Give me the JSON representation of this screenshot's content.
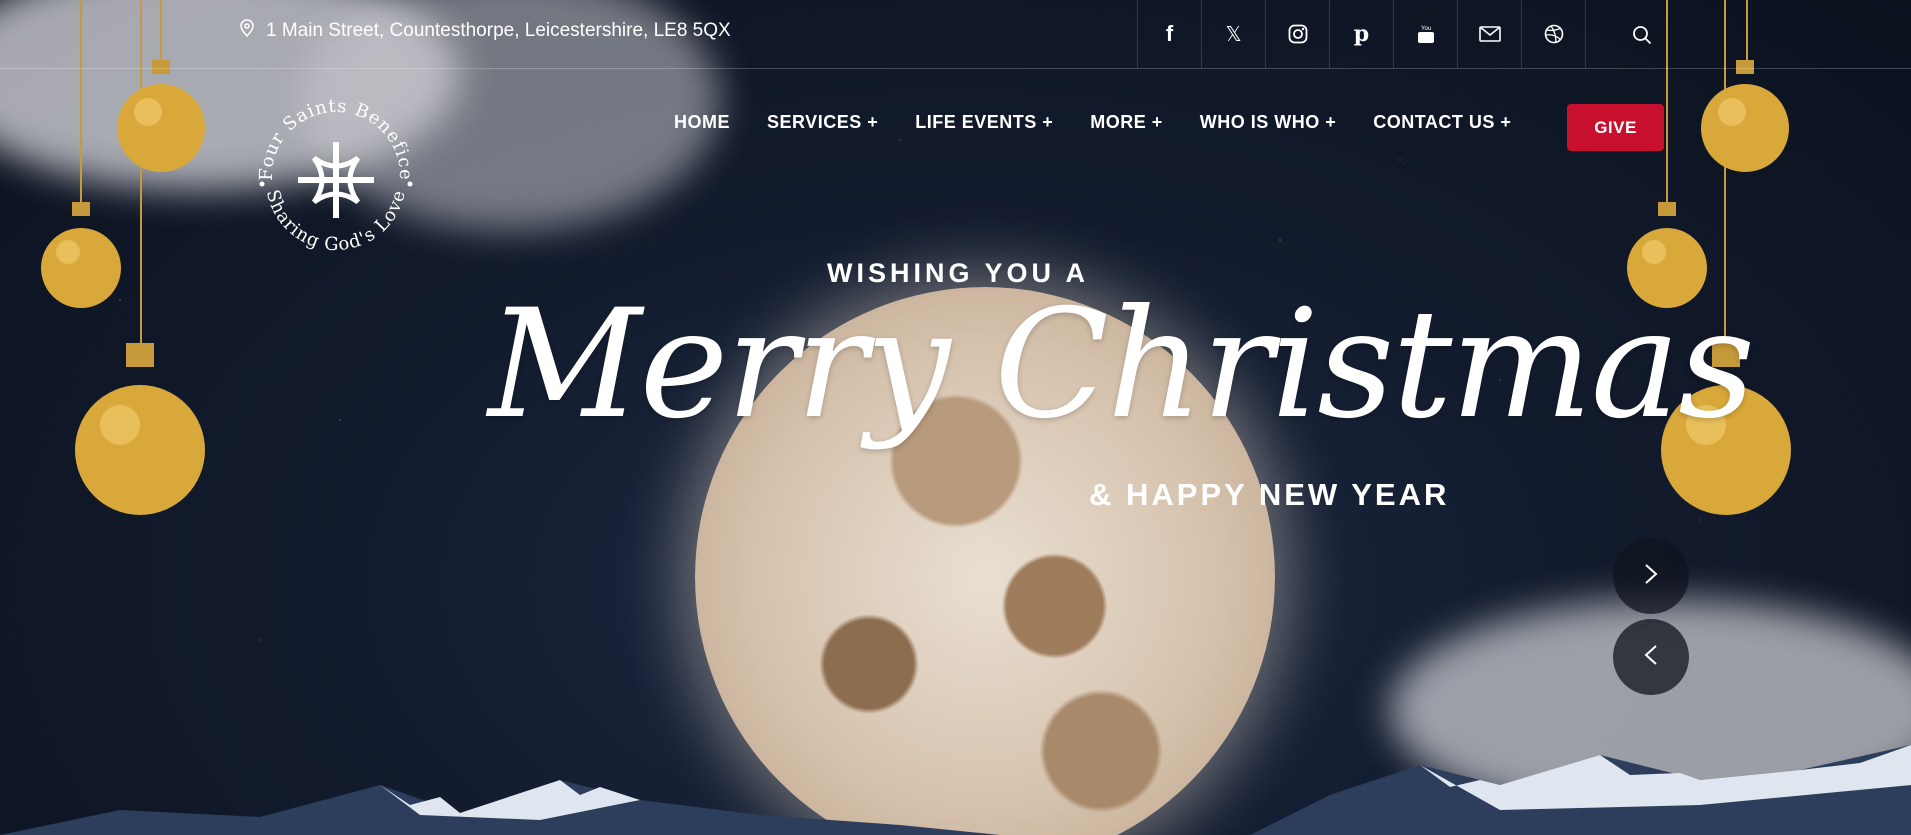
{
  "topbar": {
    "address": "1 Main Street, Countesthorpe, Leicestershire, LE8 5QX",
    "address_icon": "map-pin-icon",
    "socials": [
      {
        "name": "facebook-icon",
        "glyph": "f"
      },
      {
        "name": "x-twitter-icon",
        "glyph": "𝕏"
      },
      {
        "name": "instagram-icon",
        "glyph": "◎"
      },
      {
        "name": "pinterest-icon",
        "glyph": "𝒑"
      },
      {
        "name": "youtube-icon",
        "glyph": "▶"
      },
      {
        "name": "mail-icon",
        "glyph": "✉"
      },
      {
        "name": "dribbble-icon",
        "glyph": "⊕"
      }
    ],
    "search_icon": "search-icon"
  },
  "logo": {
    "text_top": "Four Saints Benefice",
    "text_bottom": "Sharing God's Love"
  },
  "nav": {
    "items": [
      "HOME",
      "SERVICES +",
      "LIFE EVENTS +",
      "MORE +",
      "WHO IS WHO +",
      "CONTACT US +"
    ],
    "give_label": "GIVE"
  },
  "hero": {
    "wishing": "WISHING YOU A",
    "headline": "Merry Christmas",
    "subline": "& HAPPY NEW YEAR"
  },
  "slider": {
    "next_icon": "chevron-right-icon",
    "prev_icon": "chevron-left-icon"
  },
  "colors": {
    "accent": "#c8102e",
    "background": "#131c2e",
    "ornament": "#d9a83a"
  }
}
